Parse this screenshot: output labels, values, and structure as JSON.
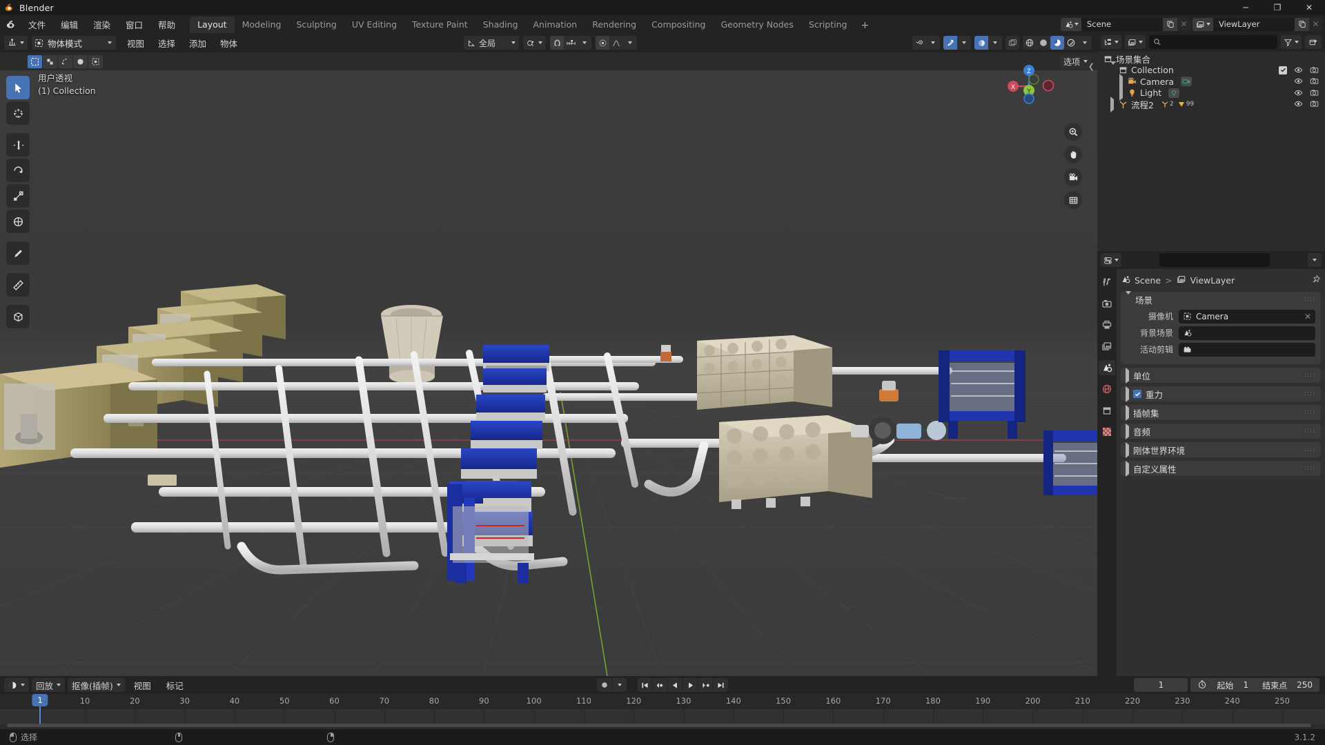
{
  "window": {
    "title": "Blender",
    "app_icon": "blender-logo-icon",
    "minimize": "─",
    "maximize": "❐",
    "close": "✕"
  },
  "top_menus": [
    "文件",
    "编辑",
    "渲染",
    "窗口",
    "帮助"
  ],
  "workspace_tabs": [
    {
      "label": "Layout",
      "active": true
    },
    {
      "label": "Modeling",
      "active": false
    },
    {
      "label": "Sculpting",
      "active": false
    },
    {
      "label": "UV Editing",
      "active": false
    },
    {
      "label": "Texture Paint",
      "active": false
    },
    {
      "label": "Shading",
      "active": false
    },
    {
      "label": "Animation",
      "active": false
    },
    {
      "label": "Rendering",
      "active": false
    },
    {
      "label": "Compositing",
      "active": false
    },
    {
      "label": "Geometry Nodes",
      "active": false
    },
    {
      "label": "Scripting",
      "active": false
    }
  ],
  "workspace_add": "+",
  "topbar_right": {
    "scene_name": "Scene",
    "viewlayer_name": "ViewLayer",
    "scene_icon": "scene-icon",
    "viewlayer_icon": "viewlayer-icon",
    "new_copy_icon": "duplicate-icon",
    "unlink_icon": "x-icon"
  },
  "viewport": {
    "editor_type_icon": "editor-type-3dview-icon",
    "mode": "物体模式",
    "menus": [
      "视图",
      "选择",
      "添加",
      "物体"
    ],
    "transform_orientation": "全局",
    "snap_icon": "magnet-icon",
    "proportional_icon": "proportional-edit-icon",
    "pivot_icon": "pivot-point-icon",
    "options_label": "选项",
    "overlay_text_line1": "用户透视",
    "overlay_text_line2": "(1) Collection",
    "gizmo_axes": [
      "X",
      "Y",
      "Z"
    ],
    "nav_buttons": [
      "zoom-icon",
      "pan-hand-icon",
      "camera-view-icon",
      "toggle-ortho-icon"
    ],
    "select_modes": [
      "select-box-icon",
      "select-tweak-icon",
      "select-lasso-icon",
      "select-circle-icon",
      "select-extend-icon"
    ],
    "shading_modes": [
      "wireframe-icon",
      "solid-icon",
      "material-preview-icon",
      "rendered-icon"
    ],
    "active_shading": "material-preview-icon",
    "tools": [
      {
        "name": "tweak-tool",
        "icon": "cursor-arrow-icon",
        "active": true
      },
      {
        "name": "cursor-tool",
        "icon": "3d-cursor-icon",
        "active": false
      },
      {
        "name": "move-tool",
        "icon": "move-arrows-icon",
        "active": false
      },
      {
        "name": "rotate-tool",
        "icon": "rotate-icon",
        "active": false
      },
      {
        "name": "scale-tool",
        "icon": "scale-icon",
        "active": false
      },
      {
        "name": "transform-tool",
        "icon": "transform-icon",
        "active": false
      },
      {
        "name": "annotate-tool",
        "icon": "pencil-icon",
        "active": false
      },
      {
        "name": "measure-tool",
        "icon": "ruler-icon",
        "active": false
      },
      {
        "name": "add-cube-tool",
        "icon": "add-cube-icon",
        "active": false
      }
    ]
  },
  "outliner": {
    "display_mode_icon": "outliner-display-icon",
    "filter_icon": "filter-funnel-icon",
    "new_collection_icon": "new-collection-icon",
    "search_placeholder": "",
    "search_icon": "search-icon",
    "rows": [
      {
        "label": "场景集合",
        "icon": "scene-collection-icon",
        "indent": 0,
        "expander": "none",
        "checkbox": false,
        "eye": false,
        "camera": false
      },
      {
        "label": "Collection",
        "icon": "collection-icon",
        "indent": 1,
        "expander": "open",
        "checkbox": true,
        "eye": true,
        "camera": true
      },
      {
        "label": "Camera",
        "icon": "camera-object-icon",
        "indent": 2,
        "expander": "closed",
        "checkbox": false,
        "eye": true,
        "camera": true,
        "data_icon": "camera-data-icon"
      },
      {
        "label": "Light",
        "icon": "light-object-icon",
        "indent": 2,
        "expander": "closed",
        "checkbox": false,
        "eye": true,
        "camera": true,
        "data_icon": "light-data-icon"
      },
      {
        "label": "流程2",
        "icon": "empty-object-icon",
        "indent": 1,
        "expander": "closed",
        "checkbox": false,
        "eye": true,
        "camera": true,
        "badge_children": "2",
        "badge_mesh": "99"
      }
    ]
  },
  "properties": {
    "editor_icon": "properties-editor-icon",
    "search_placeholder": "",
    "search_icon": "search-icon",
    "pin_icon": "pin-icon",
    "breadcrumb": {
      "scene": "Scene",
      "viewlayer": "ViewLayer",
      "separator": ">"
    },
    "tabs": [
      {
        "name": "tool-tab",
        "icon": "tool-wrench-icon",
        "active": false
      },
      {
        "name": "render-tab",
        "icon": "render-camera-icon",
        "active": false
      },
      {
        "name": "output-tab",
        "icon": "output-printer-icon",
        "active": false
      },
      {
        "name": "viewlayer-tab",
        "icon": "viewlayer-images-icon",
        "active": false
      },
      {
        "name": "scene-tab",
        "icon": "scene-cone-icon",
        "active": true
      },
      {
        "name": "world-tab",
        "icon": "world-globe-icon",
        "active": false
      },
      {
        "name": "collection-tab",
        "icon": "collection-box-icon",
        "active": false
      },
      {
        "name": "texture-tab",
        "icon": "texture-checker-icon",
        "active": false
      }
    ],
    "panels": [
      {
        "title": "场景",
        "open": true,
        "rows": [
          {
            "label": "摄像机",
            "value": "Camera",
            "icon": "camera-object-icon",
            "clear": true
          },
          {
            "label": "背景场景",
            "value": "",
            "icon": "scene-cone-icon",
            "clear": false
          },
          {
            "label": "活动剪辑",
            "value": "",
            "icon": "movie-clip-icon",
            "clear": false
          }
        ]
      },
      {
        "title": "单位",
        "open": false,
        "checkbox": null
      },
      {
        "title": "重力",
        "open": false,
        "checkbox": true
      },
      {
        "title": "插帧集",
        "open": false,
        "checkbox": null
      },
      {
        "title": "音频",
        "open": false,
        "checkbox": null
      },
      {
        "title": "刚体世界环境",
        "open": false,
        "checkbox": null
      },
      {
        "title": "自定义属性",
        "open": false,
        "checkbox": null
      }
    ]
  },
  "timeline": {
    "editor_icon": "timeline-editor-icon",
    "playback_menu": "回放",
    "keying_menu": "抠像(插帧)",
    "view_menu": "视图",
    "marker_menu": "标记",
    "record_icon": "record-dot-icon",
    "transport": [
      "jump-start-icon",
      "prev-keyframe-icon",
      "play-reverse-icon",
      "play-icon",
      "next-keyframe-icon",
      "jump-end-icon"
    ],
    "current_frame": "1",
    "timer_icon": "stopwatch-icon",
    "start_label": "起始",
    "start_value": "1",
    "end_label": "结束点",
    "end_value": "250",
    "ticks": [
      1,
      10,
      20,
      30,
      40,
      50,
      60,
      70,
      80,
      90,
      100,
      110,
      120,
      130,
      140,
      150,
      160,
      170,
      180,
      190,
      200,
      210,
      220,
      230,
      240,
      250
    ],
    "playhead_frame": 1,
    "playhead_label": "1"
  },
  "status_bar": {
    "select_label": "选择",
    "mouse_left_icon": "mouse-left-icon",
    "mouse_middle_icon": "mouse-middle-icon",
    "mouse_right_icon": "mouse-right-icon",
    "version": "3.1.2"
  },
  "colors": {
    "accent_blue": "#4772b3",
    "panel_bg": "#303030",
    "header_bg": "#232323",
    "editor_bg": "#2b2b2b",
    "viewport_bg": "#393939",
    "axis_x": "#cc4a5a",
    "axis_y": "#9cc33b",
    "axis_z": "#3b7fd4",
    "text": "#d6d6d6"
  }
}
